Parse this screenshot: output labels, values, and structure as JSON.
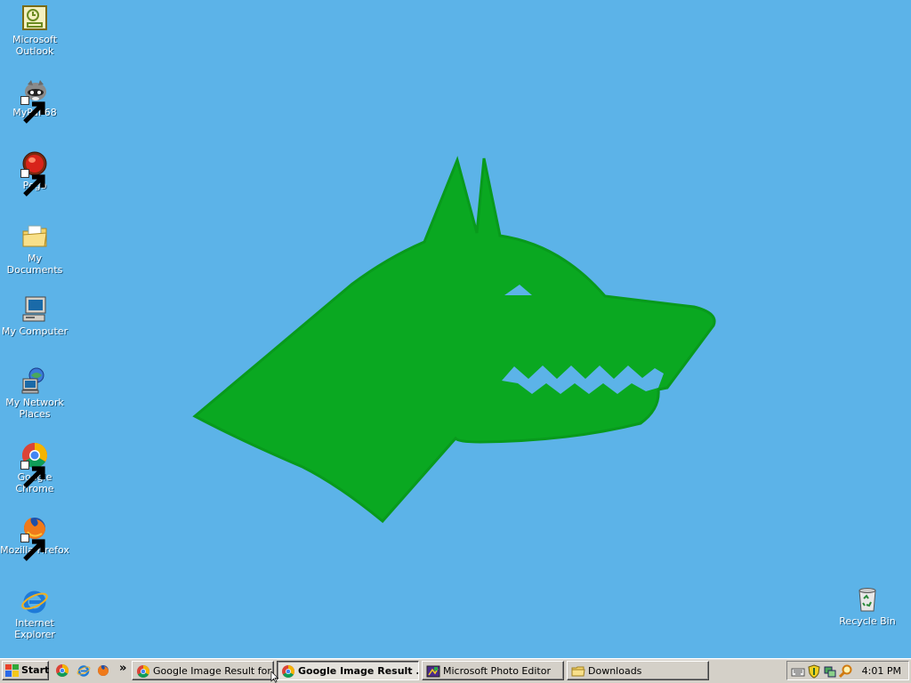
{
  "desktop": {
    "background_color": "#5cb3e8",
    "wallpaper_color": "#0aa821",
    "icons": [
      {
        "label": "Microsoft Outlook",
        "icon": "outlook-icon"
      },
      {
        "label": "MyPal 68",
        "icon": "mypal-icon"
      },
      {
        "label": "Pego",
        "icon": "pego-icon"
      },
      {
        "label": "My Documents",
        "icon": "my-documents-icon"
      },
      {
        "label": "My Computer",
        "icon": "my-computer-icon"
      },
      {
        "label": "My Network Places",
        "icon": "network-places-icon"
      },
      {
        "label": "Google Chrome",
        "icon": "chrome-icon"
      },
      {
        "label": "Mozilla Firefox",
        "icon": "firefox-icon"
      },
      {
        "label": "Internet Explorer",
        "icon": "ie-icon"
      },
      {
        "label": "Recycle Bin",
        "icon": "recycle-bin-icon"
      }
    ]
  },
  "taskbar": {
    "start_label": "Start",
    "quick_launch": [
      "chrome-icon",
      "ie-icon",
      "firefox-icon"
    ],
    "overflow_label": "»",
    "tasks": [
      {
        "label": "Google Image Result for ...",
        "active": false,
        "icon": "chrome-icon"
      },
      {
        "label": "Google Image Result ...",
        "active": true,
        "icon": "chrome-icon"
      },
      {
        "label": "Microsoft Photo Editor",
        "active": false,
        "icon": "photo-editor-icon"
      },
      {
        "label": "Downloads",
        "active": false,
        "icon": "folder-icon"
      }
    ],
    "tray_icons": [
      "keyboard-icon",
      "shield-icon",
      "network-icon",
      "search-icon"
    ],
    "clock": "4:01 PM"
  }
}
